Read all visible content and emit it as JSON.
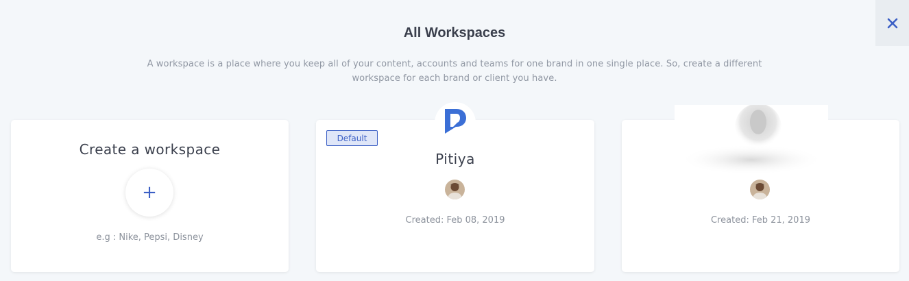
{
  "header": {
    "title": "All Workspaces",
    "description": "A workspace is a place where you keep all of your content, accounts and teams for one brand in one single place. So, create a different workspace for each brand or client you have."
  },
  "close_icon": "close-icon",
  "create_card": {
    "title": "Create a workspace",
    "plus_label": "+",
    "hint": "e.g : Nike, Pepsi, Disney"
  },
  "workspaces": [
    {
      "badge": "Default",
      "name": "Pitiya",
      "created": "Created: Feb 08, 2019",
      "logo_icon": "p-logo-icon",
      "avatar_icon": "user-avatar"
    },
    {
      "name": "",
      "created": "Created: Feb 21, 2019",
      "logo_icon": "placeholder-image-icon",
      "avatar_icon": "user-avatar"
    }
  ],
  "colors": {
    "accent": "#3b5fc5",
    "background": "#f4f7fa",
    "text_dark": "#3a3f4c",
    "text_muted": "#8c929c"
  }
}
